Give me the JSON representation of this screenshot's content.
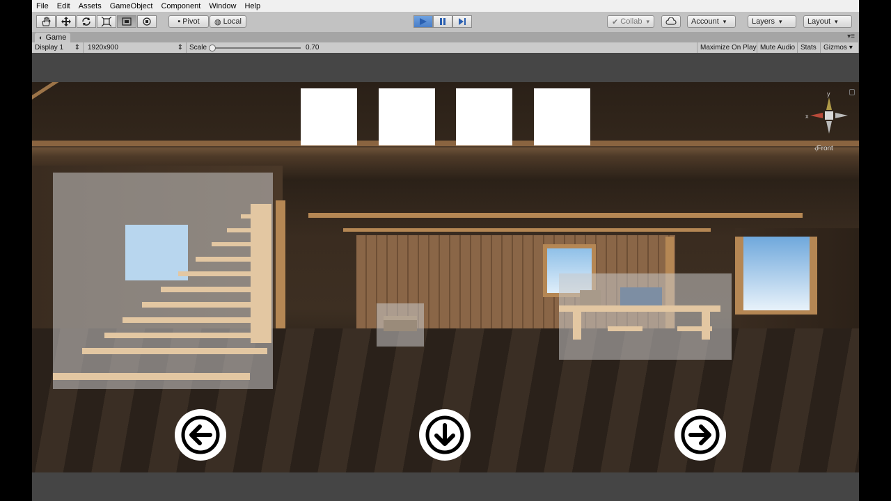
{
  "menu": [
    "File",
    "Edit",
    "Assets",
    "GameObject",
    "Component",
    "Window",
    "Help"
  ],
  "toolbar": {
    "tools": [
      "hand-icon",
      "move-icon",
      "rotate-icon",
      "scale-icon",
      "rect-icon",
      "transform-icon"
    ],
    "pivot_label": "Pivot",
    "local_label": "Local",
    "collab_label": "Collab",
    "account_label": "Account",
    "layers_label": "Layers",
    "layout_label": "Layout"
  },
  "game_tab": {
    "label": "Game"
  },
  "game_bar": {
    "display": "Display 1",
    "resolution": "1920x900",
    "scale_label": "Scale",
    "scale_value": "0.70",
    "maximize": "Maximize On Play",
    "mute": "Mute Audio",
    "stats": "Stats",
    "gizmos": "Gizmos"
  },
  "scene": {
    "gizmo_label": "Front",
    "gizmo_axes": {
      "x": "x",
      "y": "y"
    },
    "inventory_slots": 4
  }
}
